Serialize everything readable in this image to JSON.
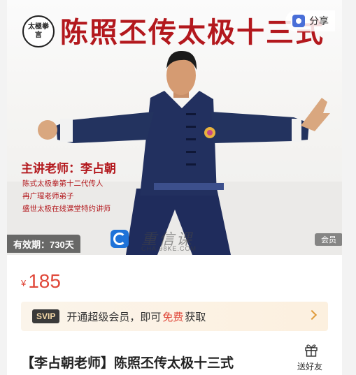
{
  "banner": {
    "logo_text": "太極拳言",
    "title": "陈照丕传太极十三式",
    "teacher_heading": "主讲老师：李占朝",
    "teacher_bio": [
      "陈式太极拳第十二代传人",
      "冉广瑆老师弟子",
      "盛世太极在线课堂特约讲师"
    ],
    "validity": "有效期：730天",
    "watermark_text": "重信课",
    "watermark_url": "CHA.98KE.COM",
    "member_badge": "会员"
  },
  "share": {
    "label": "分享"
  },
  "price": {
    "symbol": "¥",
    "value": "185"
  },
  "svip": {
    "tag": "SVIP",
    "text_before": "开通超级会员，即可",
    "free": "免费",
    "text_after": "获取"
  },
  "course": {
    "title": "【李占朝老师】陈照丕传太极十三式"
  },
  "gift": {
    "label": "送好友"
  },
  "colors": {
    "brand_red": "#b3181d",
    "price_red": "#e0483a",
    "svip_gold": "#e09a3a"
  }
}
